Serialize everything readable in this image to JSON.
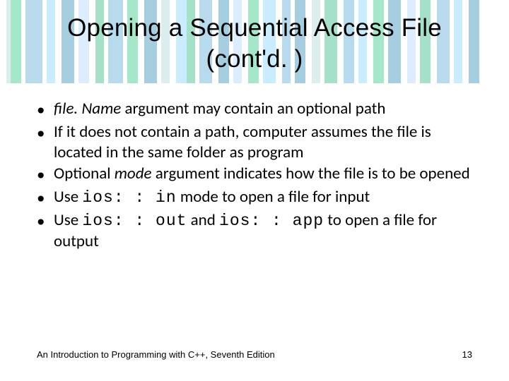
{
  "title_line1": "Opening a Sequential Access File",
  "title_line2": "(cont'd. )",
  "bullets": {
    "b1_pre": "file. Name",
    "b1_post": " argument may contain an optional path",
    "b2": "If it does not contain a path, computer assumes the file is located in the same folder as program",
    "b3_pre": "Optional ",
    "b3_mid": "mode",
    "b3_post": " argument indicates how the file is to be opened",
    "b4_pre": "Use ",
    "b4_code": "ios: : in",
    "b4_post": " mode to open a file for input",
    "b5_pre": "Use ",
    "b5_code1": "ios: : out",
    "b5_mid": " and ",
    "b5_code2": "ios: : app",
    "b5_post": " to open a file for output"
  },
  "footer": {
    "left": "An Introduction to Programming with C++, Seventh Edition",
    "page": "13"
  },
  "stripe_colors": [
    "#ffffff",
    "#9cc",
    "#0b6",
    "#fff",
    "#39c",
    "#fff",
    "#6cf",
    "#fff",
    "#07a",
    "#fff",
    "#9cf",
    "#fff",
    "#0a6",
    "#fff",
    "#39c",
    "#fff",
    "#0b6",
    "#fff",
    "#07a",
    "#fff",
    "#9cc",
    "#fff",
    "#6cf",
    "#0a6",
    "#fff",
    "#39c",
    "#fff",
    "#07a",
    "#fff",
    "#9cf",
    "#fff",
    "#0b6",
    "#fff",
    "#6cf",
    "#fff",
    "#39c",
    "#fff",
    "#07a",
    "#fff",
    "#9cc",
    "#fff",
    "#0a6",
    "#fff",
    "#39c",
    "#fff",
    "#6cf",
    "#fff",
    "#0b6",
    "#fff",
    "#07a",
    "#fff",
    "#9cf",
    "#fff",
    "#0a6",
    "#fff",
    "#39c",
    "#fff",
    "#6cf",
    "#fff",
    "#07a"
  ]
}
